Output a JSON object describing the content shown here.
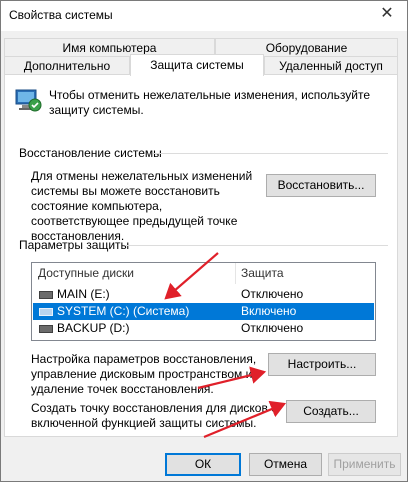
{
  "window": {
    "title": "Свойства системы",
    "close_glyph": "✕"
  },
  "tabs_row1": [
    {
      "label": "Имя компьютера"
    },
    {
      "label": "Оборудование"
    }
  ],
  "tabs_row2": [
    {
      "label": "Дополнительно"
    },
    {
      "label": "Защита системы",
      "active": true
    },
    {
      "label": "Удаленный доступ"
    }
  ],
  "intro": {
    "icon": "system-protection-icon",
    "text_line1": "Чтобы отменить нежелательные изменения, используйте",
    "text_line2": "защиту системы."
  },
  "restore": {
    "group_title": "Восстановление системы",
    "desc_line1": "Для отмены нежелательных изменений",
    "desc_line2": "системы вы можете восстановить",
    "desc_line3": "состояние компьютера,",
    "desc_line4": "соответствующее предыдущей точке",
    "desc_line5": "восстановления.",
    "button": "Восстановить..."
  },
  "protection": {
    "group_title": "Параметры защиты",
    "columns": {
      "drives": "Доступные диски",
      "protection": "Защита"
    },
    "rows": [
      {
        "name": "MAIN (E:)",
        "status": "Отключено",
        "selected": false
      },
      {
        "name": "SYSTEM (C:) (Система)",
        "status": "Включено",
        "selected": true
      },
      {
        "name": "BACKUP (D:)",
        "status": "Отключено",
        "selected": false
      }
    ]
  },
  "configure": {
    "desc_line1": "Настройка параметров восстановления,",
    "desc_line2": "управление дисковым пространством и",
    "desc_line3": "удаление точек восстановления.",
    "button": "Настроить..."
  },
  "create": {
    "desc_line1": "Создать точку восстановления для дисков с",
    "desc_line2": "включенной функцией защиты системы.",
    "button": "Создать..."
  },
  "footer": {
    "ok": "ОК",
    "cancel": "Отмена",
    "apply": "Применить"
  },
  "colors": {
    "accent": "#0078d7",
    "arrow": "#e0202a"
  }
}
